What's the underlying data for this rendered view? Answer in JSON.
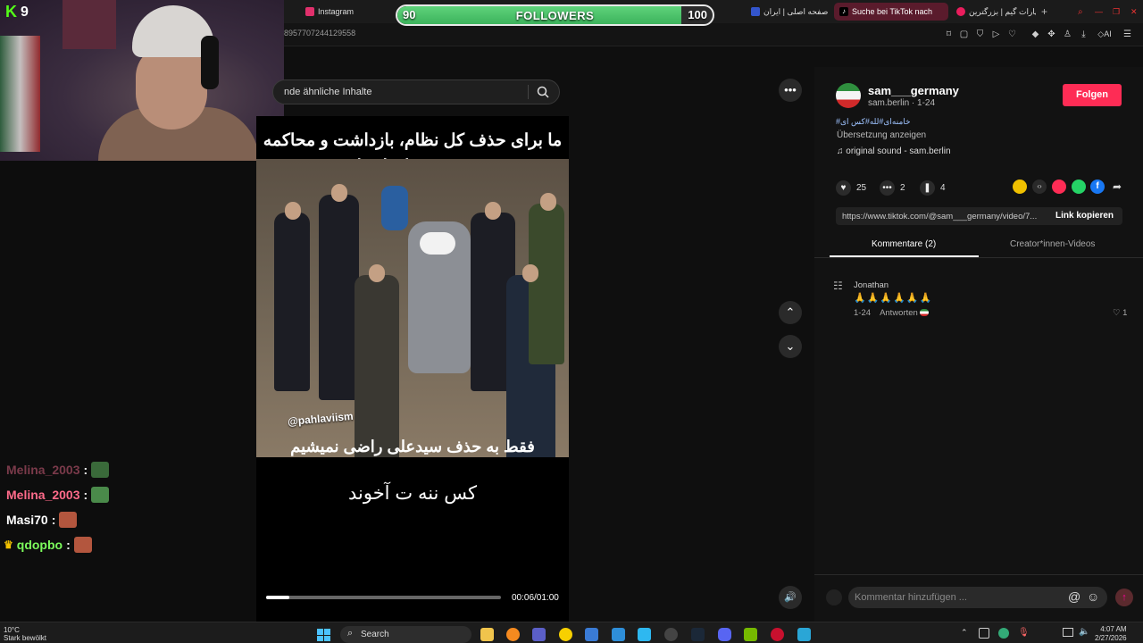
{
  "browser": {
    "tabs": [
      {
        "label": "Instagram",
        "color": "#e1306c"
      },
      {
        "label": "...",
        "color": "#444"
      },
      {
        "label": "صفحه اصلی | ایران",
        "color": "#3355cc"
      },
      {
        "label": "Suche bei TikTok nach",
        "color": "#fe2c55",
        "active": true
      },
      {
        "label": "آپارات گیم | بزرگترین",
        "color": "#ea1d5d"
      }
    ],
    "url_fragment": "895770724412955​8"
  },
  "overlay": {
    "followers_current": "90",
    "followers_goal": "100",
    "followers_label": "FOLLOWERS",
    "followers_progress": 0.9,
    "kick_count": "9"
  },
  "chat": [
    {
      "user": "Melina_2003",
      "color": "#7a3a4a",
      "suffix": ":"
    },
    {
      "user": "Melina_2003",
      "color": "#ff6b8a",
      "suffix": ":"
    },
    {
      "user": "Masi70",
      "color": "#ffffff",
      "suffix": ":"
    },
    {
      "user": "qdopbo",
      "color": "#7cfc5c",
      "suffix": ":"
    }
  ],
  "search": {
    "placeholder": "nde ähnliche Inhalte"
  },
  "video": {
    "caption_top": "ما برای حذف کل نظام، بازداشت و محاکمه همه همدستان اینجاییم",
    "handle": "@pahlaviism",
    "caption_bottom": "فقط به حذف سیدعلی راضی نمیشیم",
    "caption_overlay": "کس ننه ت آخوند",
    "time": "00:06/01:00",
    "progress": 0.1
  },
  "post": {
    "username": "sam___germany",
    "subline": "sam.berlin · 1-24",
    "follow_label": "Folgen",
    "hashtags": "#خامنه‌ای#لله#کس ای",
    "translate": "Übersetzung anzeigen",
    "sound": "original sound - sam.berlin",
    "likes": "25",
    "comments": "2",
    "saves": "4",
    "link": "https://www.tiktok.com/@sam___germany/video/7...",
    "copy_label": "Link kopieren"
  },
  "tabs": {
    "comments": "Kommentare (2)",
    "creator": "Creator*innen-Videos"
  },
  "comment": {
    "name": "Jonathan",
    "emoji": "🙏🙏🙏🙏🙏🙏",
    "date": "1-24",
    "reply": "Antworten",
    "likes": "1"
  },
  "comment_input": {
    "placeholder": "Kommentar hinzufügen ..."
  },
  "taskbar": {
    "weather_temp": "10°C",
    "weather_desc": "Stark bewölkt",
    "search_label": "Search",
    "time": "4:07 AM",
    "date": "2/27/2026"
  }
}
